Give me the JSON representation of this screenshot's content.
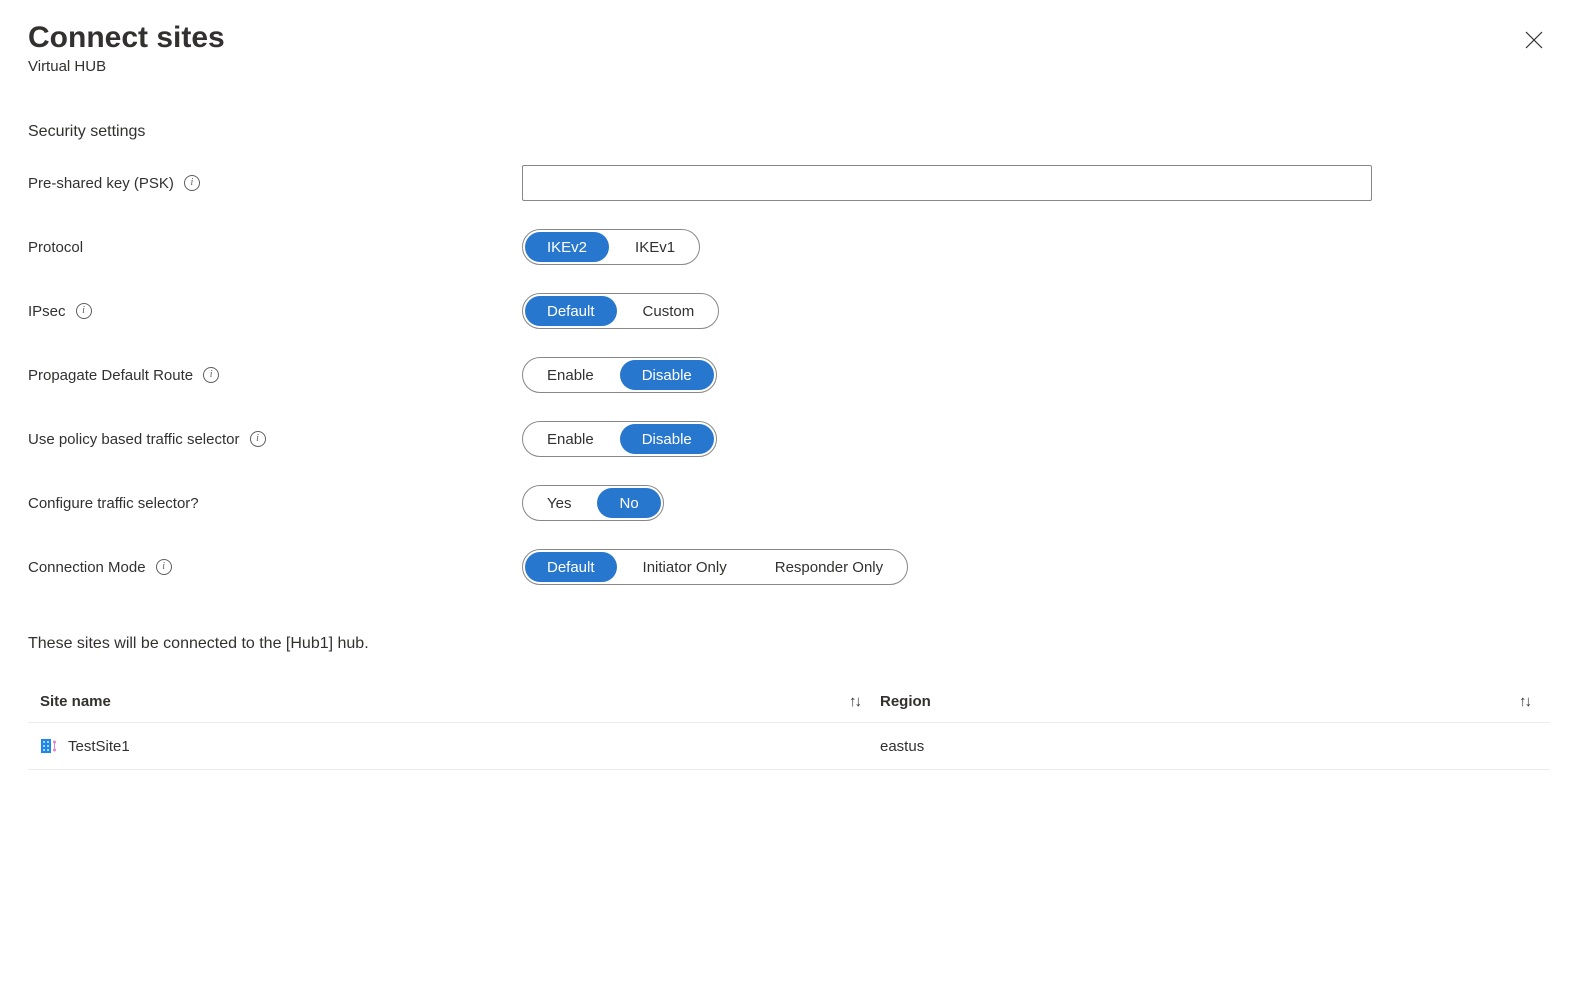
{
  "header": {
    "title": "Connect sites",
    "subtitle": "Virtual HUB"
  },
  "section": {
    "security_heading": "Security settings"
  },
  "fields": {
    "psk": {
      "label": "Pre-shared key (PSK)",
      "value": ""
    },
    "protocol": {
      "label": "Protocol",
      "opt1": "IKEv2",
      "opt2": "IKEv1"
    },
    "ipsec": {
      "label": "IPsec",
      "opt1": "Default",
      "opt2": "Custom"
    },
    "propagate": {
      "label": "Propagate Default Route",
      "opt1": "Enable",
      "opt2": "Disable"
    },
    "policy_selector": {
      "label": "Use policy based traffic selector",
      "opt1": "Enable",
      "opt2": "Disable"
    },
    "configure_selector": {
      "label": "Configure traffic selector?",
      "opt1": "Yes",
      "opt2": "No"
    },
    "conn_mode": {
      "label": "Connection Mode",
      "opt1": "Default",
      "opt2": "Initiator Only",
      "opt3": "Responder Only"
    }
  },
  "connected_message": "These sites will be connected to the [Hub1] hub.",
  "table": {
    "col_sitename": "Site name",
    "col_region": "Region",
    "rows": [
      {
        "name": "TestSite1",
        "region": "eastus"
      }
    ]
  }
}
